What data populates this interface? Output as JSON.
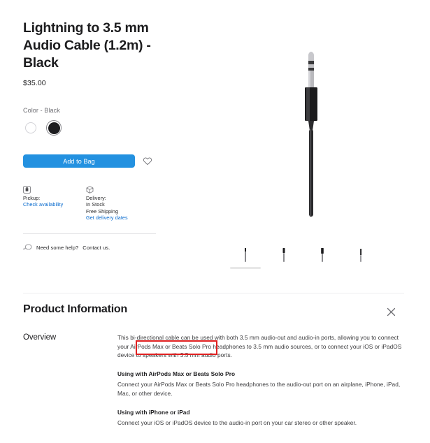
{
  "product": {
    "title": "Lightning to 3.5 mm Audio Cable (1.2m) - Black",
    "price": "$35.00",
    "color_label": "Color - Black",
    "colors": [
      {
        "name": "white",
        "hex": "#ffffff",
        "selected": false
      },
      {
        "name": "black",
        "hex": "#1d1d1f",
        "selected": true
      }
    ],
    "add_to_bag_label": "Add to Bag",
    "favorite_icon": "heart-icon",
    "accent_color": "#2391e0",
    "link_color": "#0066cc"
  },
  "fulfillment": {
    "pickup": {
      "icon": "shopping-bag-icon",
      "heading": "Pickup:",
      "link": "Check availability"
    },
    "delivery": {
      "icon": "package-box-icon",
      "heading": "Delivery:",
      "stock": "In Stock",
      "shipping": "Free Shipping",
      "link": "Get delivery dates"
    }
  },
  "help": {
    "icon": "chat-bubble-icon",
    "text": "Need some help?",
    "link": "Contact us."
  },
  "gallery": {
    "hero_alt": "3.5 mm audio jack connector with black cable",
    "thumbnails": [
      {
        "name": "thumbnail-1",
        "selected": true
      },
      {
        "name": "thumbnail-2",
        "selected": false
      },
      {
        "name": "thumbnail-3",
        "selected": false
      },
      {
        "name": "thumbnail-4",
        "selected": false
      }
    ]
  },
  "product_information": {
    "title": "Product Information",
    "close_icon": "close-x-icon",
    "overview_label": "Overview",
    "overview_paragraph": "This bi-directional cable can be used with both 3.5 mm audio-out and audio-in ports, allowing you to connect your AirPods Max or Beats Solo Pro headphones to 3.5 mm audio sources, or to connect your iOS or iPadOS device to speakers with 3.5 mm audio ports.",
    "sections": [
      {
        "heading": "Using with AirPods Max or Beats Solo Pro",
        "body": "Connect your AirPods Max or Beats Solo Pro headphones to the audio-out port on an airplane, iPhone, iPad, Mac, or other device."
      },
      {
        "heading": "Using with iPhone or iPad",
        "body": "Connect your iOS or iPadOS device to the audio-in port on your car stereo or other speaker."
      }
    ]
  },
  "annotation": {
    "color": "#e02020",
    "target_text": "connect your AirPods Max"
  }
}
